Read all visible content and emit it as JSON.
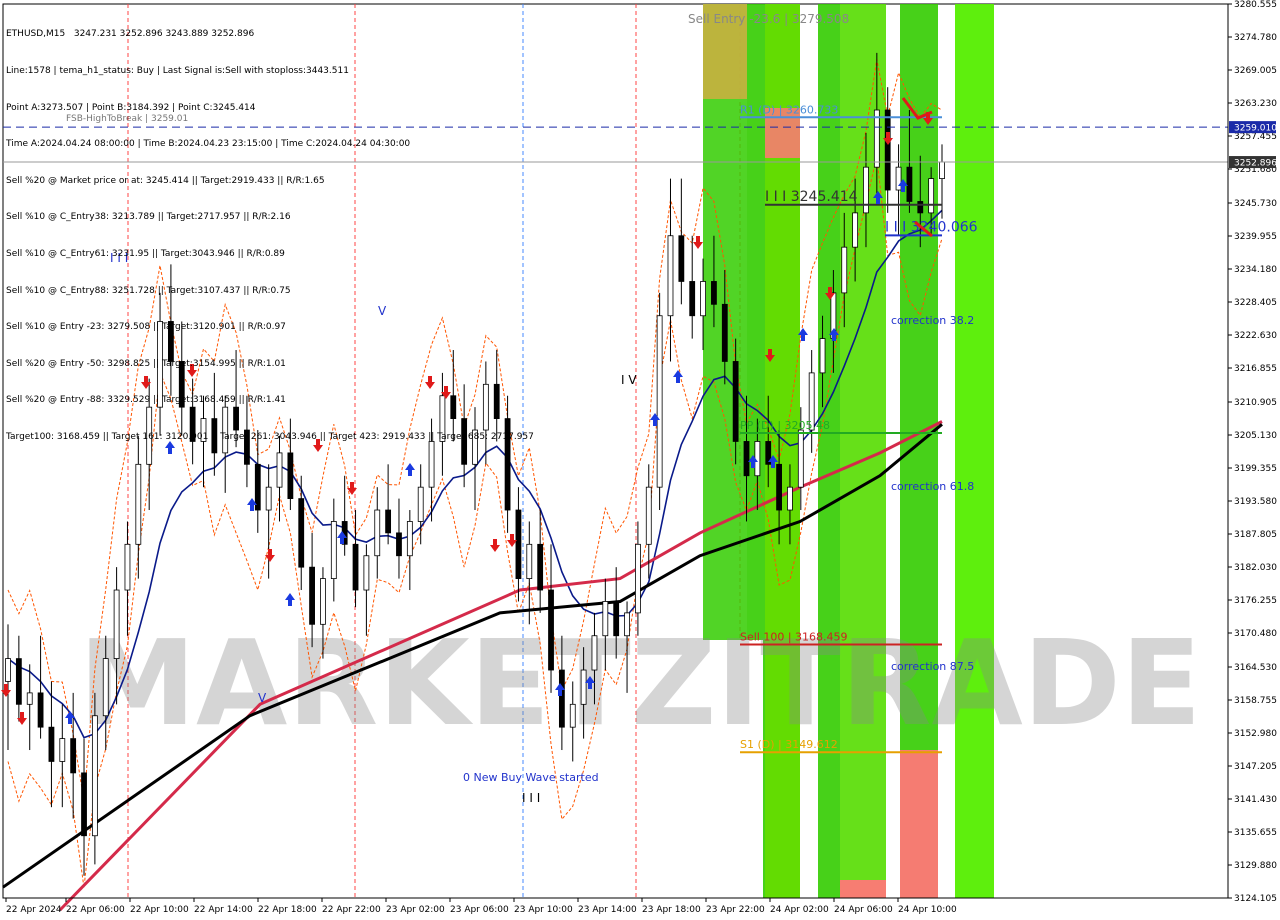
{
  "info": {
    "lines": [
      "ETHUSD,M15   3247.231 3252.896 3243.889 3252.896",
      "Line:1578 | tema_h1_status: Buy | Last Signal is:Sell with stoploss:3443.511",
      "Point A:3273.507 | Point B:3184.392 | Point C:3245.414",
      "Time A:2024.04.24 08:00:00 | Time B:2024.04.23 23:15:00 | Time C:2024.04.24 04:30:00",
      "Sell %20 @ Market price or at: 3245.414 || Target:2919.433 || R/R:1.65",
      "Sell %10 @ C_Entry38: 3213.789 || Target:2717.957 || R/R:2.16",
      "Sell %10 @ C_Entry61: 3231.95 || Target:3043.946 || R/R:0.89",
      "Sell %10 @ C_Entry88: 3251.728 || Target:3107.437 || R/R:0.75",
      "Sell %10 @ Entry -23: 3279.508 || Target:3120.901 || R/R:0.97",
      "Sell %20 @ Entry -50: 3298.825 || Target:3154.995 || R/R:1.01",
      "Sell %20 @ Entry -88: 3329.529 || Target:3168.459 || R/R:1.41",
      "Target100: 3168.459 || Target 161: 3120.901 || Target 261: 3043.946 || Target 423: 2919.433 || Target 685: 2717.957"
    ],
    "overlay_text": "FSB-HighToBreak | 3259.01"
  },
  "chart_data": {
    "type": "candlestick",
    "symbol": "ETHUSD",
    "timeframe": "M15",
    "ylim": [
      3124.105,
      3280.555
    ],
    "y_ticks": [
      "3280.555",
      "3274.780",
      "3269.005",
      "3263.230",
      "3257.455",
      "3251.680",
      "3245.730",
      "3239.955",
      "3234.180",
      "3228.405",
      "3222.630",
      "3216.855",
      "3210.905",
      "3205.130",
      "3199.355",
      "3193.580",
      "3187.805",
      "3182.030",
      "3176.255",
      "3170.480",
      "3164.530",
      "3158.755",
      "3152.980",
      "3147.205",
      "3141.430",
      "3135.655",
      "3129.880",
      "3124.105"
    ],
    "x_ticks": [
      "22 Apr 2024",
      "22 Apr 06:00",
      "22 Apr 10:00",
      "22 Apr 14:00",
      "22 Apr 18:00",
      "22 Apr 22:00",
      "23 Apr 02:00",
      "23 Apr 06:00",
      "23 Apr 10:00",
      "23 Apr 14:00",
      "23 Apr 18:00",
      "23 Apr 22:00",
      "24 Apr 02:00",
      "24 Apr 06:00",
      "24 Apr 10:00"
    ],
    "current_price": "3252.896",
    "fsb_price": "3259.010",
    "levels": [
      {
        "label": "R1 (D) | 3260.733",
        "value": 3260.733,
        "color": "#4a8fd8"
      },
      {
        "label": "I I I 3245.414",
        "value": 3245.414,
        "color": "#333333"
      },
      {
        "label": "I I I 3240.066",
        "value": 3240.066,
        "color": "#2233cc"
      },
      {
        "label": "PP (D) | 3205.48",
        "value": 3205.48,
        "color": "#22aa22"
      },
      {
        "label": "Sell 100 | 3168.459",
        "value": 3168.459,
        "color": "#cc2222"
      },
      {
        "label": "S1 (D) | 3149.612",
        "value": 3149.612,
        "color": "#e6a000"
      }
    ],
    "annotations": [
      {
        "text": "Sell Entry -23.6 | 3279.508",
        "color": "#888888"
      },
      {
        "text": "correction 38.2",
        "color": "#2233cc"
      },
      {
        "text": "correction 61.8",
        "color": "#2233cc"
      },
      {
        "text": "correction 87.5",
        "color": "#2233cc"
      },
      {
        "text": "0 New Buy Wave started",
        "color": "#2233cc"
      }
    ],
    "marks": {
      "v_top": "I I I",
      "v_mid": "V",
      "v_low": "V",
      "v_bottom": "I I I",
      "v_arrow": "I V"
    },
    "watermark": "MARKETZITRADE",
    "colors": {
      "bull_zone": "#33cc00",
      "bear_zone": "#ff7777",
      "tan_zone": "#c8b040",
      "ma_blue": "#0a1a8a",
      "ma_red": "#d42a4a",
      "ma_black": "#000000",
      "envelope": "#ff5500"
    },
    "candles_ohlc": [
      [
        3162,
        3172,
        3150,
        3166
      ],
      [
        3166,
        3170,
        3155,
        3158
      ],
      [
        3158,
        3165,
        3150,
        3160
      ],
      [
        3160,
        3170,
        3152,
        3154
      ],
      [
        3154,
        3162,
        3140,
        3148
      ],
      [
        3148,
        3158,
        3140,
        3152
      ],
      [
        3152,
        3160,
        3138,
        3146
      ],
      [
        3146,
        3152,
        3128,
        3135
      ],
      [
        3135,
        3160,
        3130,
        3156
      ],
      [
        3156,
        3170,
        3150,
        3166
      ],
      [
        3166,
        3182,
        3158,
        3178
      ],
      [
        3178,
        3190,
        3170,
        3186
      ],
      [
        3186,
        3205,
        3180,
        3200
      ],
      [
        3200,
        3215,
        3192,
        3210
      ],
      [
        3210,
        3230,
        3205,
        3225
      ],
      [
        3225,
        3235,
        3212,
        3218
      ],
      [
        3218,
        3225,
        3205,
        3210
      ],
      [
        3210,
        3215,
        3200,
        3204
      ],
      [
        3204,
        3212,
        3196,
        3208
      ],
      [
        3208,
        3216,
        3198,
        3202
      ],
      [
        3202,
        3212,
        3195,
        3210
      ],
      [
        3210,
        3220,
        3203,
        3206
      ],
      [
        3206,
        3212,
        3196,
        3200
      ],
      [
        3200,
        3206,
        3188,
        3192
      ],
      [
        3192,
        3200,
        3180,
        3196
      ],
      [
        3196,
        3205,
        3190,
        3202
      ],
      [
        3202,
        3208,
        3192,
        3194
      ],
      [
        3194,
        3198,
        3178,
        3182
      ],
      [
        3182,
        3188,
        3168,
        3172
      ],
      [
        3172,
        3182,
        3166,
        3180
      ],
      [
        3180,
        3194,
        3176,
        3190
      ],
      [
        3190,
        3198,
        3184,
        3186
      ],
      [
        3186,
        3192,
        3175,
        3178
      ],
      [
        3178,
        3186,
        3170,
        3184
      ],
      [
        3184,
        3196,
        3180,
        3192
      ],
      [
        3192,
        3200,
        3186,
        3188
      ],
      [
        3188,
        3194,
        3180,
        3184
      ],
      [
        3184,
        3192,
        3178,
        3190
      ],
      [
        3190,
        3200,
        3186,
        3196
      ],
      [
        3196,
        3208,
        3190,
        3204
      ],
      [
        3204,
        3216,
        3198,
        3212
      ],
      [
        3212,
        3220,
        3204,
        3208
      ],
      [
        3208,
        3214,
        3196,
        3200
      ],
      [
        3200,
        3210,
        3192,
        3206
      ],
      [
        3206,
        3218,
        3200,
        3214
      ],
      [
        3214,
        3220,
        3204,
        3208
      ],
      [
        3208,
        3212,
        3188,
        3192
      ],
      [
        3192,
        3196,
        3176,
        3180
      ],
      [
        3180,
        3190,
        3172,
        3186
      ],
      [
        3186,
        3192,
        3174,
        3178
      ],
      [
        3178,
        3186,
        3160,
        3164
      ],
      [
        3164,
        3170,
        3150,
        3154
      ],
      [
        3154,
        3162,
        3148,
        3158
      ],
      [
        3158,
        3168,
        3152,
        3164
      ],
      [
        3164,
        3174,
        3158,
        3170
      ],
      [
        3170,
        3180,
        3164,
        3176
      ],
      [
        3176,
        3182,
        3166,
        3170
      ],
      [
        3170,
        3176,
        3160,
        3174
      ],
      [
        3174,
        3190,
        3170,
        3186
      ],
      [
        3186,
        3200,
        3180,
        3196
      ],
      [
        3196,
        3230,
        3192,
        3226
      ],
      [
        3226,
        3250,
        3218,
        3240
      ],
      [
        3240,
        3250,
        3228,
        3232
      ],
      [
        3232,
        3240,
        3222,
        3226
      ],
      [
        3226,
        3236,
        3220,
        3232
      ],
      [
        3232,
        3240,
        3224,
        3228
      ],
      [
        3228,
        3234,
        3214,
        3218
      ],
      [
        3218,
        3222,
        3200,
        3204
      ],
      [
        3204,
        3212,
        3190,
        3198
      ],
      [
        3198,
        3208,
        3192,
        3204
      ],
      [
        3204,
        3212,
        3196,
        3200
      ],
      [
        3200,
        3206,
        3186,
        3192
      ],
      [
        3192,
        3200,
        3186,
        3196
      ],
      [
        3196,
        3210,
        3192,
        3206
      ],
      [
        3206,
        3220,
        3202,
        3216
      ],
      [
        3216,
        3226,
        3210,
        3222
      ],
      [
        3222,
        3234,
        3216,
        3230
      ],
      [
        3230,
        3244,
        3224,
        3238
      ],
      [
        3238,
        3250,
        3232,
        3244
      ],
      [
        3244,
        3258,
        3238,
        3252
      ],
      [
        3252,
        3272,
        3246,
        3262
      ],
      [
        3262,
        3266,
        3244,
        3248
      ],
      [
        3248,
        3256,
        3240,
        3252
      ],
      [
        3252,
        3262,
        3244,
        3246
      ],
      [
        3246,
        3254,
        3238,
        3244
      ],
      [
        3244,
        3252,
        3240,
        3250
      ],
      [
        3250,
        3256,
        3243,
        3252.9
      ]
    ]
  }
}
